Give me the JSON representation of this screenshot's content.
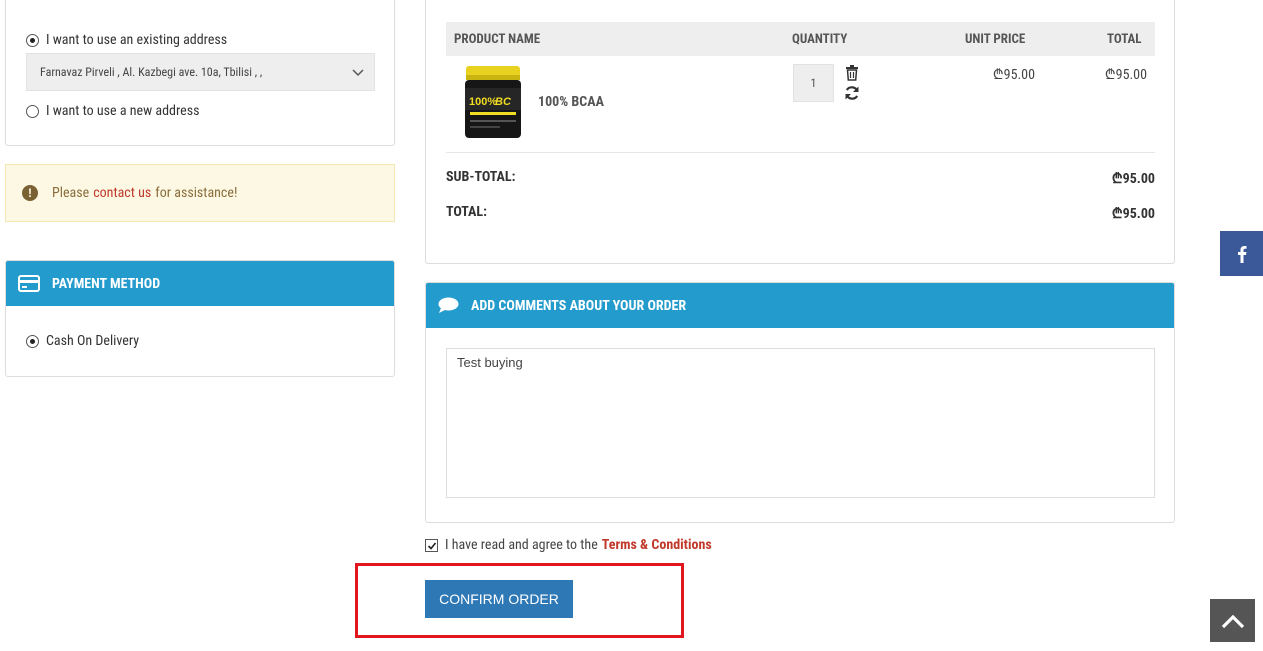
{
  "shipping_address": {
    "existing_option_label": "I want to use an existing address",
    "existing_selected": true,
    "selected_address": "Farnavaz Pirveli , Al. Kazbegi ave. 10a, Tbilisi , ,",
    "new_option_label": "I want to use a new address"
  },
  "alert": {
    "prefix": "Please",
    "link_text": "contact us",
    "suffix": "for assistance!"
  },
  "payment": {
    "heading": "PAYMENT METHOD",
    "option_label": "Cash On Delivery"
  },
  "cart": {
    "headers": {
      "product_name": "PRODUCT NAME",
      "quantity": "QUANTITY",
      "unit_price": "UNIT PRICE",
      "total": "TOTAL"
    },
    "items": [
      {
        "name": "100% BCAA",
        "quantity": "1",
        "unit_price": "₾95.00",
        "total": "₾95.00"
      }
    ],
    "subtotal_label": "SUB-TOTAL:",
    "subtotal_value": "₾95.00",
    "total_label": "TOTAL:",
    "total_value": "₾95.00"
  },
  "comments": {
    "heading": "ADD COMMENTS ABOUT YOUR ORDER",
    "text": "Test buying"
  },
  "agreement": {
    "label": "I have read and agree to the",
    "link_text": "Terms & Conditions",
    "checked": true
  },
  "confirm_button_label": "CONFIRM ORDER",
  "colors": {
    "panel_header": "#239bcc",
    "button": "#2f78b6",
    "link_red": "#c0392b",
    "highlight": "#e0171f",
    "facebook": "#3b5898"
  }
}
